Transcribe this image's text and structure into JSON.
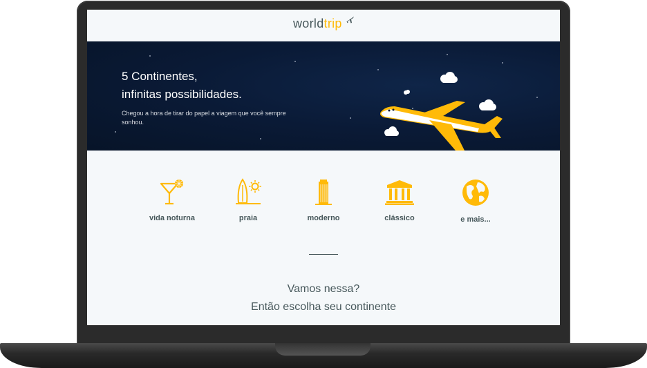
{
  "header": {
    "logo_world": "world",
    "logo_trip": "trip"
  },
  "hero": {
    "title_line1": "5 Continentes,",
    "title_line2": "infinitas possibilidades.",
    "subtitle": "Chegou a hora de tirar do papel a viagem que você sempre sonhou."
  },
  "categories": [
    {
      "label": "vida noturna",
      "icon": "cocktail-icon"
    },
    {
      "label": "praia",
      "icon": "surfboard-sun-icon"
    },
    {
      "label": "moderno",
      "icon": "building-icon"
    },
    {
      "label": "clássico",
      "icon": "museum-icon"
    },
    {
      "label": "e mais...",
      "icon": "globe-icon"
    }
  ],
  "cta": {
    "line1": "Vamos nessa?",
    "line2": "Então escolha seu continente"
  },
  "colors": {
    "accent": "#ffba08",
    "text": "#47585b",
    "hero_bg": "#0a1a36",
    "page_bg": "#f5f8fa"
  }
}
